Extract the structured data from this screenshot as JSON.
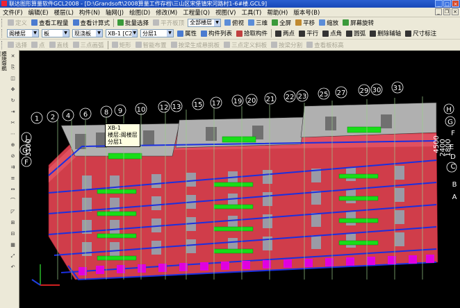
{
  "title": "联达图形算量软件GCL2008 - [D:\\Grandsoft\\2008算量工作存档\\三山区宋堡镇宋河路村1-6#楼.GCL9]",
  "menu": [
    "文件(F)",
    "编辑(E)",
    "楼层(L)",
    "构件(N)",
    "轴网(J)",
    "绘图(D)",
    "修改(M)",
    "工程量(Q)",
    "视图(V)",
    "工具(T)",
    "帮助(H)",
    "版本号(B)"
  ],
  "toolbar1": {
    "define": "定义",
    "view_quantity": "查看工程量",
    "view_formula": "查看计算式",
    "batch_select": "批量选择",
    "flat_slab": "平齐板顶",
    "floor_scope": "全部楼层",
    "view_dir": "俯视",
    "three_d": "三维",
    "fullscreen": "全屏",
    "pan": "平移",
    "zoom": "缩放",
    "rotate": "屏幕旋转"
  },
  "toolbar2": {
    "floor": "阁楼层",
    "type": "板",
    "subtype": "现浇板",
    "element": "XB-1 [C2",
    "layer": "分层1",
    "properties": "属性",
    "component_list": "构件列表",
    "pick_component": "拾取构件",
    "two_point": "两点",
    "parallel": "平行",
    "point_angle": "点角",
    "arc": "圆弧",
    "delete_aux": "删除辅轴",
    "dimension": "尺寸标注"
  },
  "toolbar3": {
    "select": "选择",
    "point": "点",
    "line": "直线",
    "three_point_arc": "三点画弧",
    "rect": "矩形",
    "smart_layout": "智能布置",
    "gen_by_beam": "按梁生成悬挑板",
    "three_point_slope": "三点定义斜板",
    "split_by_beam": "按梁分割",
    "view_slab_info": "查看板标高"
  },
  "leftbar": {
    "nav_label": "模块导航栏"
  },
  "tooltip": {
    "line1": "XB-1",
    "line2": "楼层:阁楼层",
    "line3": "分层1"
  },
  "axis_numbers": [
    "1",
    "2",
    "4",
    "6",
    "8",
    "9",
    "10",
    "12",
    "13",
    "15",
    "17",
    "19",
    "20",
    "21",
    "22",
    "23",
    "25",
    "27",
    "29",
    "30",
    "31"
  ],
  "right_labels": [
    "H",
    "G",
    "F",
    "E",
    "D",
    "C",
    "B",
    "A"
  ],
  "left_labels": [
    "J",
    "G",
    "F"
  ],
  "dimension_labels": {
    "left": "3100",
    "right1": "4500",
    "right2": "2400",
    "right3": "1800"
  },
  "colors": {
    "wall": "#d03d4a",
    "beam": "#1a2fe0",
    "slab": "#b0b0b0",
    "balcony": "#18dd18",
    "foundation": "#e000e0",
    "aux_axis": "#9ccc8c"
  }
}
